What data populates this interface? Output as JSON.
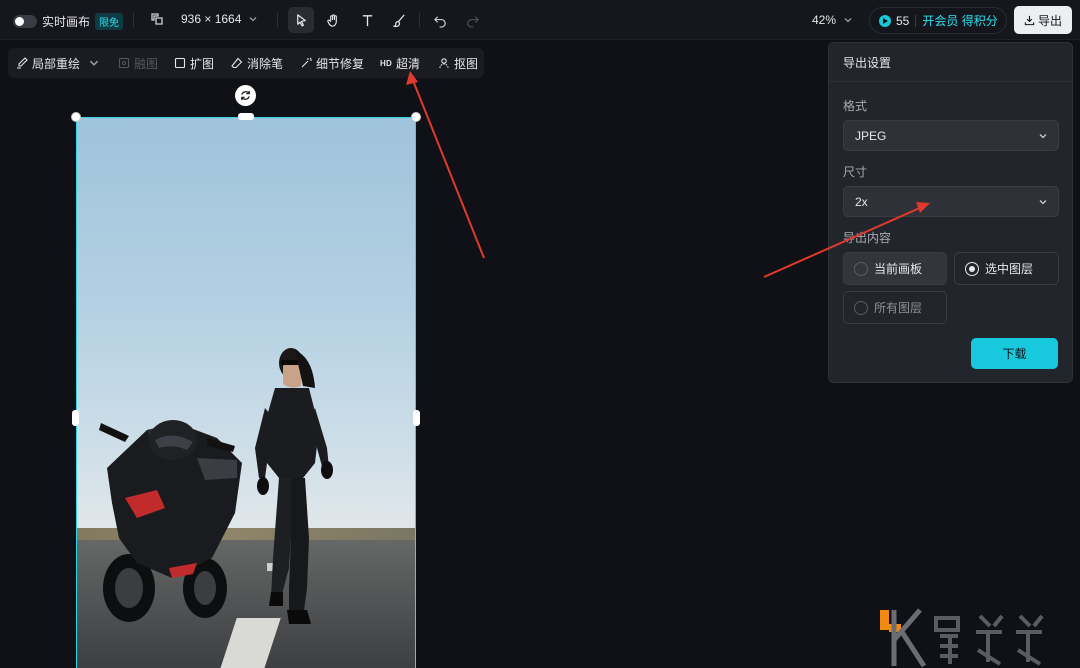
{
  "topbar": {
    "realtime_label": "实时画布",
    "free_badge": "限免",
    "canvas_size": "936 × 1664",
    "zoom": "42%",
    "points": "55",
    "vip_label": "开会员 得积分",
    "export_label": "导出"
  },
  "toolbar2": {
    "items": [
      {
        "label": "局部重绘"
      },
      {
        "label": "融图"
      },
      {
        "label": "扩图"
      },
      {
        "label": "消除笔"
      },
      {
        "label": "细节修复"
      },
      {
        "hd": "HD",
        "label": "超清"
      },
      {
        "label": "抠图"
      }
    ]
  },
  "export_panel": {
    "title": "导出设置",
    "format_label": "格式",
    "format_value": "JPEG",
    "size_label": "尺寸",
    "size_value": "2x",
    "content_label": "导出内容",
    "options": [
      {
        "label": "当前画板",
        "selected": false
      },
      {
        "label": "选中图层",
        "selected": true
      },
      {
        "label": "所有图层",
        "selected": false
      }
    ],
    "download_label": "下载"
  },
  "colors": {
    "accent": "#18c8dc",
    "annotation_arrow": "#e03a2c"
  }
}
